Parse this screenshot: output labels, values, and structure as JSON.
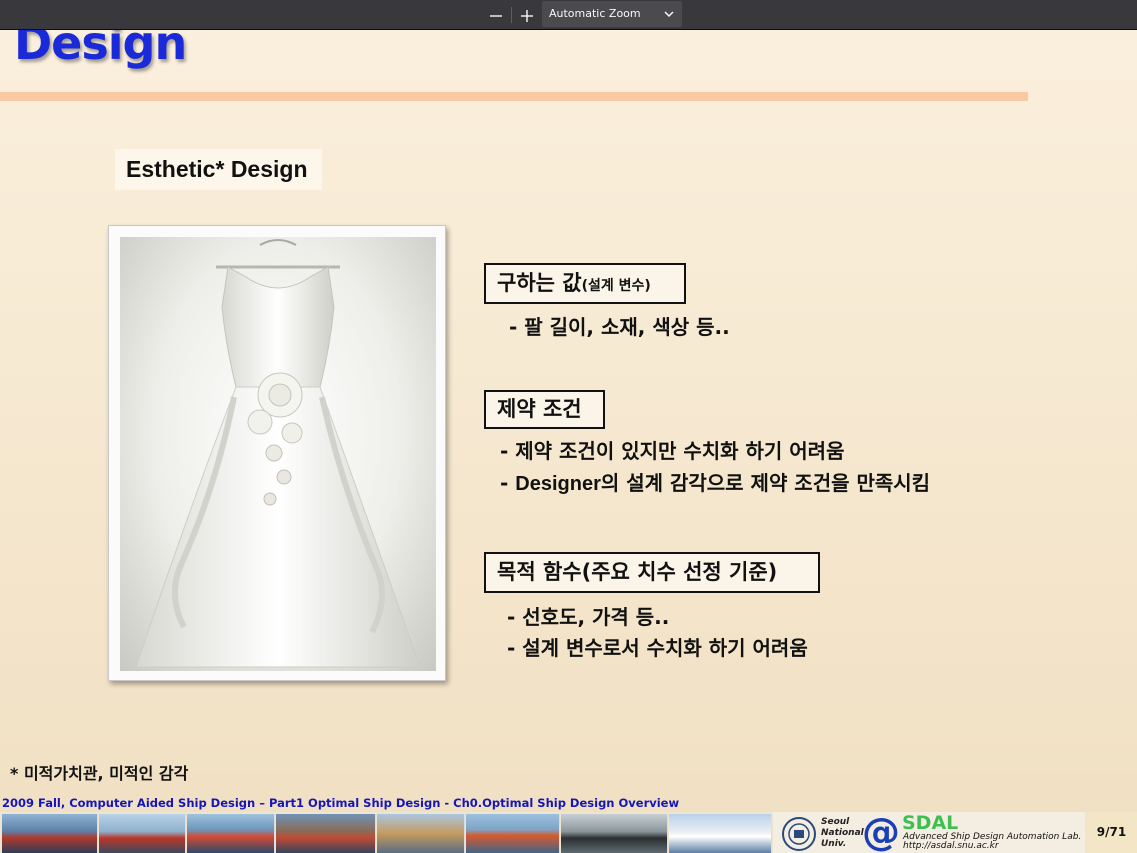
{
  "toolbar": {
    "zoom_out_symbol": "—",
    "zoom_in_symbol": "+",
    "zoom_value": "Automatic Zoom"
  },
  "slide": {
    "title": "Design",
    "section_title": "Esthetic* Design",
    "box1": {
      "main": "구하는 값",
      "small": "(설계 변수)"
    },
    "box1_items": [
      "- 팔 길이, 소재, 색상 등.."
    ],
    "box2": {
      "main": "제약 조건"
    },
    "box2_items": [
      "- 제약 조건이 있지만 수치화 하기 어려움",
      {
        "prefix": "- ",
        "latin": "Designer",
        "rest": "의 설계 감각으로 제약 조건을 만족시킴"
      }
    ],
    "box3": {
      "main": "목적 함수(주요 치수 선정 기준)"
    },
    "box3_items": [
      "- 선호도, 가격 등..",
      "- 설계 변수로서 수치화 하기 어려움"
    ],
    "footnote": "* 미적가치관, 미적인 감각",
    "course_footer": "2009 Fall,  Computer Aided Ship Design – Part1 Optimal Ship Design  - Ch0.Optimal Ship Design Overview"
  },
  "logos": {
    "snu_lines": [
      "Seoul",
      "National",
      "Univ."
    ],
    "sdal_name": "SDAL",
    "sdal_sub1": "Advanced Ship Design Automation Lab.",
    "sdal_sub2": "http://asdal.snu.ac.kr"
  },
  "page_number": "9/71",
  "colors": {
    "toolbar_bg": "#38383d",
    "title_blue": "#1a2ad8",
    "rule_peach": "#f9c9a3",
    "footer_blue": "#1616b8",
    "sdal_green": "#3fbf52"
  },
  "icons": [
    "zoom-out-icon",
    "zoom-in-icon",
    "chevron-down-icon",
    "snu-emblem-icon"
  ]
}
